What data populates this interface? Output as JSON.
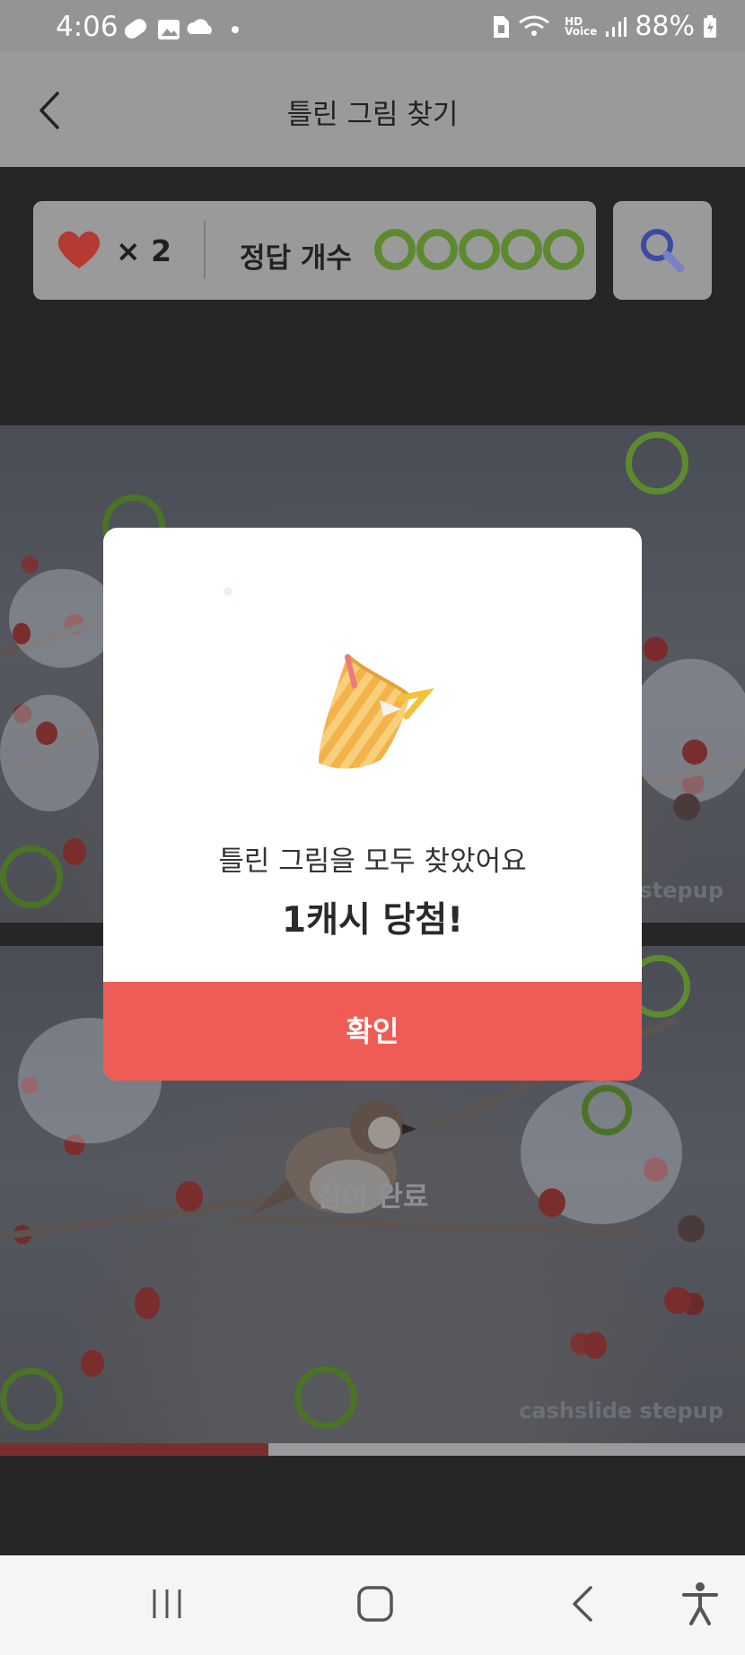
{
  "status_bar": {
    "time": "4:06",
    "battery": "88%",
    "hd_label": "HD",
    "voice_label": "Voice",
    "left_icons": [
      "pill-icon",
      "gallery-icon",
      "cloud-icon",
      "dot-icon"
    ]
  },
  "header": {
    "title": "틀린 그림 찾기"
  },
  "game": {
    "lives_label": "× 2",
    "lives": 2,
    "answers_label": "정답 개수",
    "answers_found": 5,
    "answers_total": 5,
    "complete_label": "참여 완료",
    "watermark": "cashslide stepup",
    "progress": 0.36
  },
  "modal": {
    "message": "틀린 그림을 모두 찾았어요",
    "reward": "1캐시 당첨!",
    "confirm_label": "확인"
  },
  "colors": {
    "accent": "#ef5c55",
    "found_circle": "#5d8a2f",
    "heart": "#c0392b"
  }
}
